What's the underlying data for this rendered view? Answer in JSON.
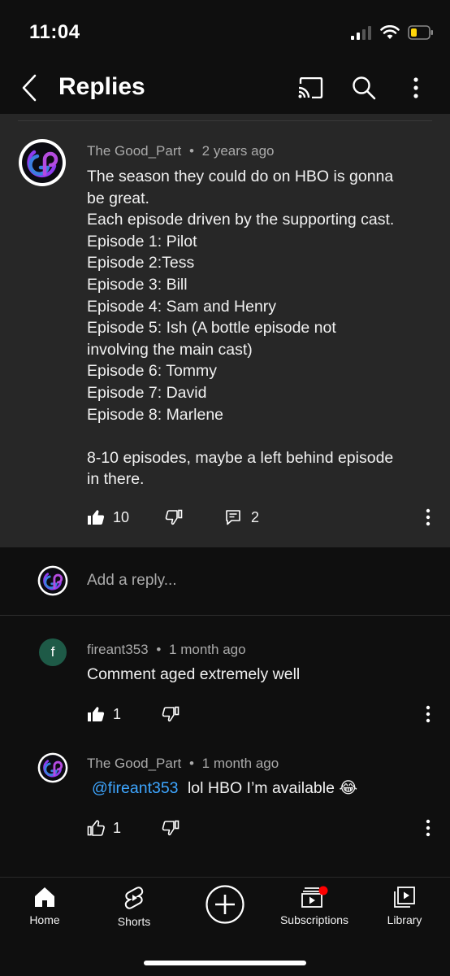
{
  "status_bar": {
    "time": "11:04"
  },
  "header": {
    "title": "Replies"
  },
  "main_comment": {
    "author": "The Good_Part",
    "time": "2 years ago",
    "text": "The season they could do on HBO is gonna\nbe great.\nEach episode driven by the supporting cast.\nEpisode 1: Pilot\nEpisode 2:Tess\nEpisode 3: Bill\nEpisode 4: Sam and Henry\nEpisode 5: Ish (A bottle episode not\ninvolving the main cast)\nEpisode 6: Tommy\nEpisode 7: David\nEpisode 8: Marlene\n\n8-10 episodes, maybe a left behind episode\nin there.",
    "likes": "10",
    "replies": "2"
  },
  "reply_input": {
    "placeholder": "Add a reply..."
  },
  "replies": [
    {
      "avatar_letter": "f",
      "author": "fireant353",
      "time": "1 month ago",
      "text": "Comment aged extremely well",
      "likes": "1"
    },
    {
      "author": "The Good_Part",
      "time": "1 month ago",
      "mention": "@fireant353",
      "text": "lol HBO I’m available",
      "emoji": "😂",
      "likes": "1"
    }
  ],
  "meta_separator": "•",
  "bottom_nav": {
    "home": "Home",
    "shorts": "Shorts",
    "subscriptions": "Subscriptions",
    "library": "Library"
  },
  "colors": {
    "background": "#0f0f0f",
    "card": "#272727",
    "mention": "#3ea6ff",
    "notification_dot": "#ff0000",
    "battery": "#ffd60a"
  },
  "icons": {
    "back": "chevron-left-icon",
    "cast": "cast-icon",
    "search": "search-icon",
    "more": "more-vert-icon",
    "like": "thumb-up-icon",
    "dislike": "thumb-down-icon",
    "reply": "comment-icon",
    "create": "add-circle-icon"
  }
}
